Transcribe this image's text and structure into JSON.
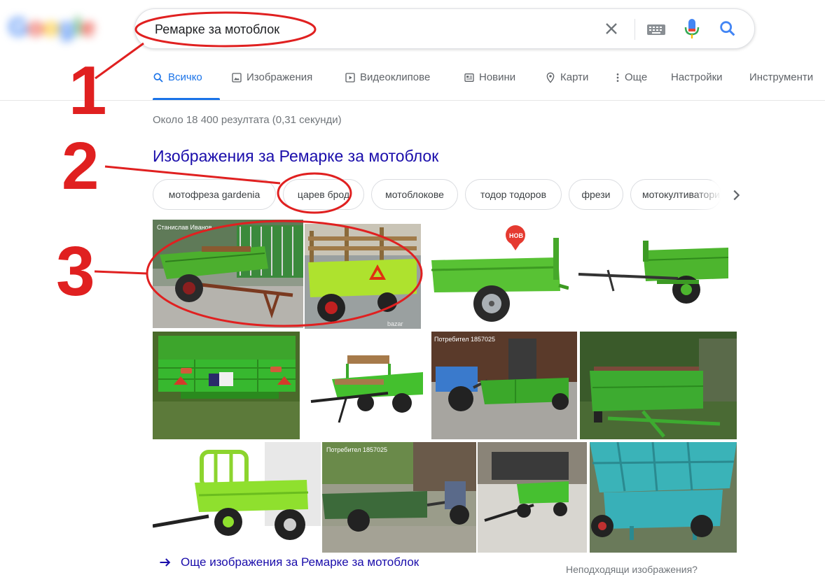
{
  "search": {
    "query": "Ремарке за мотоблок"
  },
  "tabs": [
    {
      "label": "Всичко",
      "icon": "search-icon"
    },
    {
      "label": "Изображения",
      "icon": "image-icon"
    },
    {
      "label": "Видеоклипове",
      "icon": "video-icon"
    },
    {
      "label": "Новини",
      "icon": "news-icon"
    },
    {
      "label": "Карти",
      "icon": "map-pin-icon"
    },
    {
      "label": "Още",
      "icon": "more-vert-icon"
    },
    {
      "label": "Настройки"
    },
    {
      "label": "Инструменти"
    }
  ],
  "stats": "Около 18 400 резултата (0,31 секунди)",
  "images_section": {
    "heading": "Изображения за Ремарке за мотоблок",
    "chips": [
      "мотофреза gardenia",
      "царев брод",
      "мотоблокове",
      "тодор тодоров",
      "фрези",
      "мотокултиватори"
    ],
    "thumb_captions": [
      "Станислав Иванов",
      "Потребител 1857025",
      "Потребител 1857025"
    ],
    "badge": "НОВ",
    "more_link": "Още изображения за Ремарке за мотоблок",
    "unsuitable": "Неподходящи изображения?"
  },
  "annotations": [
    "1",
    "2",
    "3"
  ],
  "colors": {
    "link": "#1a0dab",
    "accent": "#1a73e8",
    "annotation": "#e02020",
    "trailer_green": "#4caf2e"
  }
}
